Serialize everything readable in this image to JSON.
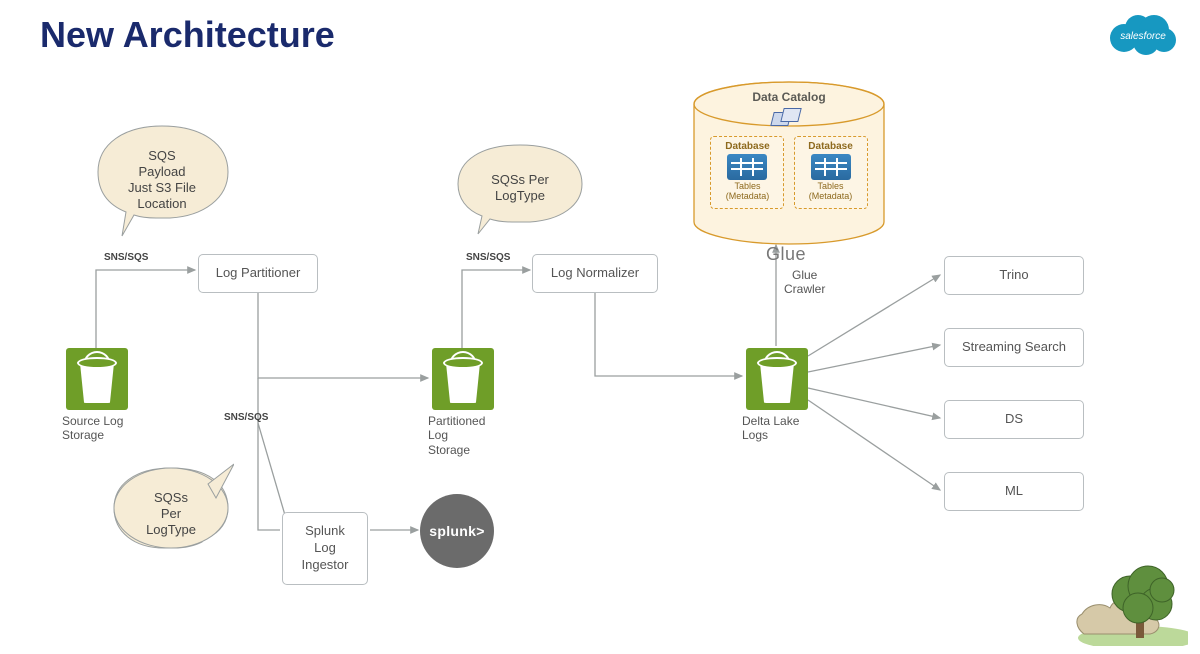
{
  "title": "New Architecture",
  "brand": "salesforce",
  "callouts": {
    "sqsPayload": "SQS\nPayload\nJust S3 File\nLocation",
    "sqsPerLogTypeTop": "SQSs Per\nLogType",
    "sqsPerLogTypeBottom": "SQSs\nPer\nLogType"
  },
  "lineLabels": {
    "a": "SNS/SQS",
    "b": "SNS/SQS",
    "c": "SNS/SQS"
  },
  "nodes": {
    "logPartitioner": "Log Partitioner",
    "logNormalizer": "Log Normalizer",
    "splunkIngestor": "Splunk Log\nIngestor",
    "trino": "Trino",
    "streamingSearch": "Streaming Search",
    "ds": "DS",
    "ml": "ML"
  },
  "captions": {
    "sourceLog": "Source Log\nStorage",
    "partitionedLog": "Partitioned\nLog\nStorage",
    "deltaLake": "Delta Lake\nLogs"
  },
  "glue": {
    "crawler": "Glue\nCrawler",
    "dataCatalog": "Data Catalog",
    "database": "Database",
    "tablesMeta": "Tables\n(Metadata)",
    "caption": "Glue"
  },
  "splunk": "splunk>"
}
